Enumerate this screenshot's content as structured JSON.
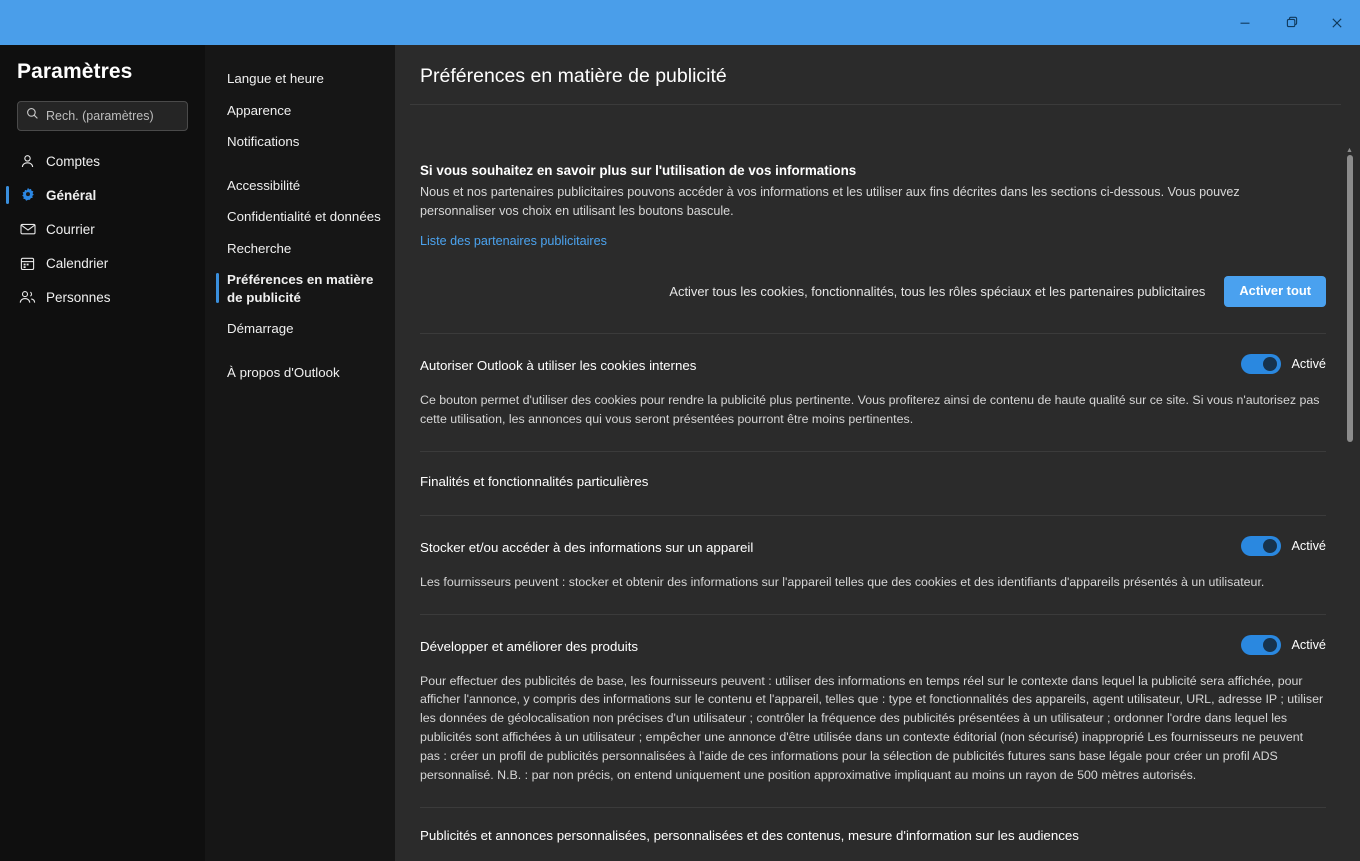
{
  "window": {
    "accent_color": "#4a9eea",
    "controls": [
      {
        "name": "minimize",
        "glyph": "minimize-icon"
      },
      {
        "name": "restore",
        "glyph": "restore-icon"
      },
      {
        "name": "close",
        "glyph": "close-icon"
      }
    ]
  },
  "sidebar": {
    "title": "Paramètres",
    "search": {
      "placeholder": "Rech. (paramètres)",
      "value": ""
    },
    "items": [
      {
        "label": "Comptes",
        "icon": "person-icon",
        "active": false
      },
      {
        "label": "Général",
        "icon": "gear-icon",
        "active": true
      },
      {
        "label": "Courrier",
        "icon": "mail-icon",
        "active": false
      },
      {
        "label": "Calendrier",
        "icon": "calendar-icon",
        "active": false
      },
      {
        "label": "Personnes",
        "icon": "people-icon",
        "active": false
      }
    ]
  },
  "subnav": {
    "items": [
      {
        "label": "Langue et heure",
        "active": false
      },
      {
        "label": "Apparence",
        "active": false
      },
      {
        "label": "Notifications",
        "active": false
      },
      {
        "label": "Accessibilité",
        "active": false
      },
      {
        "label": "Confidentialité et données",
        "active": false
      },
      {
        "label": "Recherche",
        "active": false
      },
      {
        "label": "Préférences en matière de publicité",
        "active": true
      },
      {
        "label": "Démarrage",
        "active": false
      },
      {
        "label": "À propos d'Outlook",
        "active": false
      }
    ]
  },
  "main": {
    "title": "Préférences en matière de publicité",
    "intro": {
      "heading": "Si vous souhaitez en savoir plus sur l'utilisation de vos informations",
      "body": "Nous et nos partenaires publicitaires pouvons accéder à vos informations et les utiliser aux fins décrites dans les sections ci-dessous. Vous pouvez personnaliser vos choix en utilisant les boutons bascule.",
      "link": "Liste des partenaires publicitaires"
    },
    "enable_all": {
      "label": "Activer tous les cookies, fonctionnalités, tous les rôles spéciaux et les partenaires publicitaires",
      "button": "Activer tout"
    },
    "cookies_pref": {
      "title": "Autoriser Outlook à utiliser les cookies internes",
      "toggle_state": "Activé",
      "description": "Ce bouton permet d'utiliser des cookies pour rendre la publicité plus pertinente. Vous profiterez ainsi de contenu de haute qualité sur ce site. Si vous n'autorisez pas cette utilisation, les annonces qui vous seront présentées pourront être moins pertinentes."
    },
    "group_title": "Finalités et fonctionnalités particulières",
    "store_pref": {
      "title": "Stocker et/ou accéder à des informations sur un appareil",
      "toggle_state": "Activé",
      "description": "Les fournisseurs peuvent : stocker et obtenir des informations sur l'appareil telles que des cookies et des identifiants d'appareils présentés à un utilisateur."
    },
    "develop_pref": {
      "title": "Développer et améliorer des produits",
      "toggle_state": "Activé",
      "description": "Pour effectuer des publicités de base, les fournisseurs peuvent : utiliser des informations en temps réel sur le contexte dans lequel la publicité sera affichée, pour afficher l'annonce, y compris des informations sur le contenu et l'appareil, telles que : type et fonctionnalités des appareils, agent utilisateur, URL, adresse IP ; utiliser les données de géolocalisation non précises d'un utilisateur ; contrôler la fréquence des publicités présentées à un utilisateur ; ordonner l'ordre dans lequel les publicités sont affichées à un utilisateur ; empêcher une annonce d'être utilisée dans un contexte éditorial (non sécurisé) inapproprié Les fournisseurs ne peuvent pas : créer un profil de publicités personnalisées à l'aide de ces informations pour la sélection de publicités futures sans base légale pour créer un profil ADS personnalisé. N.B. : par non précis, on entend uniquement une position approximative impliquant au moins un rayon de 500 mètres autorisés."
    },
    "next_pref_clipped": "Publicités et annonces personnalisées, personnalisées et des contenus, mesure d'information sur les audiences"
  }
}
